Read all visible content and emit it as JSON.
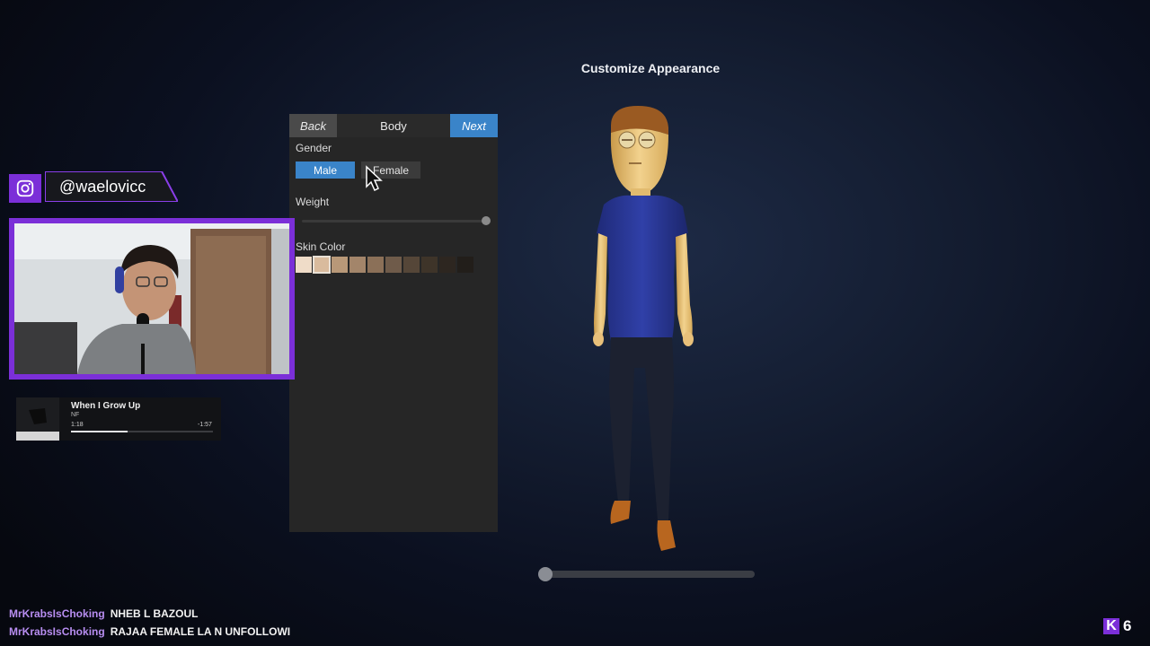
{
  "screen": {
    "title": "Customize Appearance"
  },
  "panel": {
    "back_label": "Back",
    "title": "Body",
    "next_label": "Next",
    "gender_label": "Gender",
    "gender_options": [
      "Male",
      "Female"
    ],
    "gender_selected": "Male",
    "weight_label": "Weight",
    "weight_value": 1.0,
    "skin_label": "Skin Color",
    "skin_colors": [
      "#efdcc8",
      "#d9bb9d",
      "#b89878",
      "#a3856a",
      "#8b7058",
      "#6f5b4a",
      "#554638",
      "#3e3429",
      "#2d2620",
      "#221e1a"
    ],
    "skin_selected_index": 1
  },
  "rotation_slider": {
    "value": 0.03
  },
  "social": {
    "instagram_handle": "@waelovicc",
    "icon": "instagram-icon"
  },
  "music": {
    "song": "When I Grow Up",
    "artist": "NF",
    "elapsed": "1:18",
    "remaining": "-1:57",
    "progress": 0.4
  },
  "chat": [
    {
      "user": "MrKrabsIsChoking",
      "message": "NHEB L BAZOUL"
    },
    {
      "user": "MrKrabsIsChoking",
      "message": "RAJAA FEMALE LA N UNFOLLOWI"
    }
  ],
  "viewers": {
    "count": "6",
    "icon": "kick-logo-icon"
  },
  "colors": {
    "accent_blue": "#3a84c9",
    "stream_purple": "#7b2fd8",
    "chat_user": "#b78df0"
  }
}
